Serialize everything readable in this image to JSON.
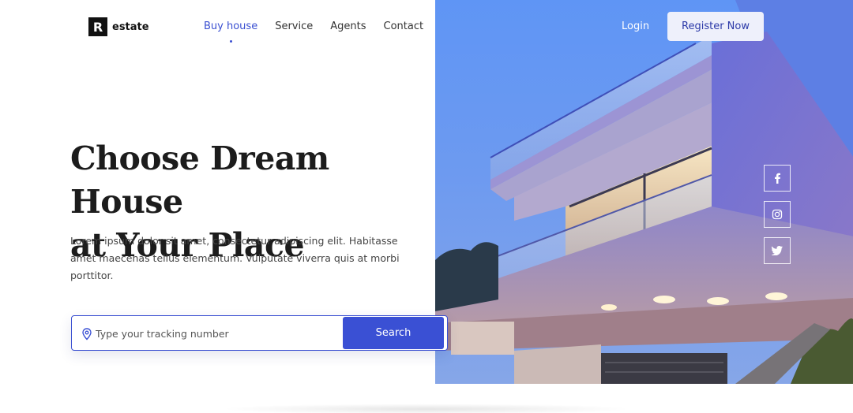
{
  "brand": {
    "mark": "R",
    "name": "estate"
  },
  "nav": {
    "items": [
      {
        "label": "Buy house",
        "active": true
      },
      {
        "label": "Service",
        "active": false
      },
      {
        "label": "Agents",
        "active": false
      },
      {
        "label": "Contact",
        "active": false
      }
    ]
  },
  "auth": {
    "login_label": "Login",
    "register_label": "Register Now"
  },
  "hero": {
    "headline_line1": "Choose Dream House",
    "headline_line2": "at Your Place",
    "description": "Lorem ipsum dolor sit amet, consectetur adipiscing elit. Habitasse amet maecenas tellus elementum. Vulputate viverra quis at morbi porttitor."
  },
  "search": {
    "placeholder": "Type your tracking number",
    "value": "",
    "button_label": "Search",
    "icon": "location-pin-icon"
  },
  "social": [
    "facebook-icon",
    "instagram-icon",
    "twitter-icon"
  ],
  "colors": {
    "accent": "#3a50d4",
    "sky": "#6d9af0",
    "register_bg": "#eef0fb"
  }
}
